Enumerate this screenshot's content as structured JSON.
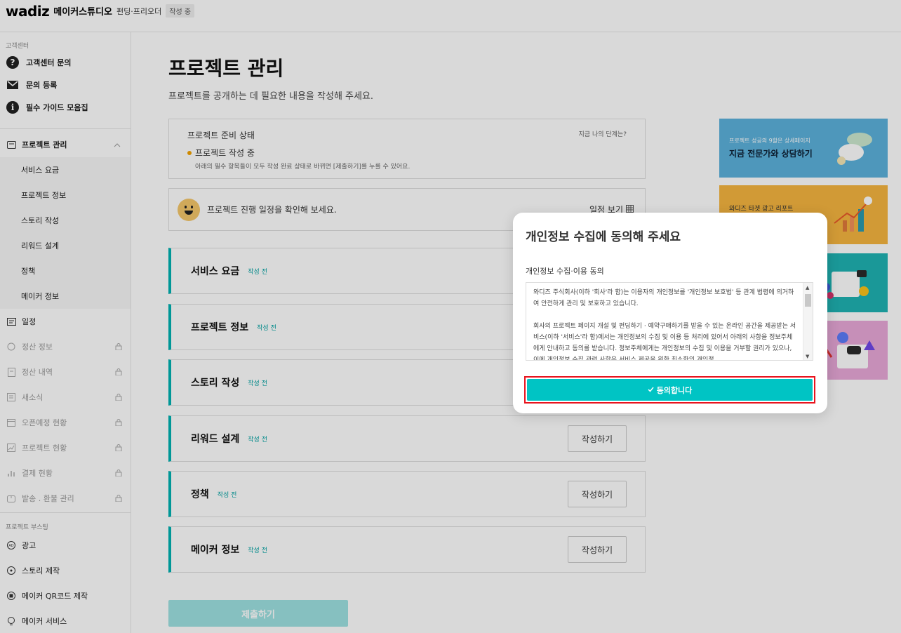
{
  "header": {
    "logo": "wadiz",
    "studio": "메이커스튜디오",
    "subtitle": "펀딩·프리오더",
    "badge": "작성 중"
  },
  "sidebar": {
    "support_label": "고객센터",
    "support_items": [
      {
        "label": "고객센터 문의",
        "icon": "question-icon"
      },
      {
        "label": "문의 등록",
        "icon": "mail-icon"
      },
      {
        "label": "필수 가이드 모음집",
        "icon": "info-icon"
      }
    ],
    "project_manage": "프로젝트 관리",
    "project_sub": [
      "서비스 요금",
      "프로젝트 정보",
      "스토리 작성",
      "리워드 설계",
      "정책",
      "메이커 정보"
    ],
    "schedule": "일정",
    "locked_items": [
      "정산 정보",
      "정산 내역",
      "새소식",
      "오픈예정 현황",
      "프로젝트 현황",
      "결제 현황",
      "발송 . 환불 관리"
    ],
    "boost_label": "프로젝트 부스팅",
    "boost_items": [
      "광고",
      "스토리 제작",
      "메이커 QR코드 제작",
      "메이커 서비스"
    ]
  },
  "main": {
    "title": "프로젝트 관리",
    "desc": "프로젝트를 공개하는 데 필요한 내용을 작성해 주세요.",
    "status": {
      "title": "프로젝트 준비 상태",
      "question": "지금 나의 단계는?",
      "state": "프로젝트 작성 중",
      "note": "아래의 필수 항목들이 모두 작성 완료 상태로 바뀌면 [제출하기]를 누를 수 있어요."
    },
    "schedule": {
      "text": "프로젝트 진행 일정을 확인해 보세요.",
      "link": "일정 보기"
    },
    "sections": [
      {
        "title": "서비스 요금",
        "status": "작성 전",
        "button": ""
      },
      {
        "title": "프로젝트 정보",
        "status": "작성 전",
        "button": ""
      },
      {
        "title": "스토리 작성",
        "status": "작성 전",
        "button": ""
      },
      {
        "title": "리워드 설계",
        "status": "작성 전",
        "button": "작성하기"
      },
      {
        "title": "정책",
        "status": "작성 전",
        "button": "작성하기"
      },
      {
        "title": "메이커 정보",
        "status": "작성 전",
        "button": "작성하기"
      }
    ],
    "submit": "제출하기"
  },
  "banners": [
    {
      "small": "프로젝트 성공의 9할은 상세페이지",
      "big": "지금 전문가와 상담하기"
    },
    {
      "small": "와디즈 타겟 광고 리포트"
    }
  ],
  "modal": {
    "title": "개인정보 수집에 동의해 주세요",
    "label": "개인정보 수집·이용 동의",
    "terms_p1": "와디즈 주식회사(이하 '회사'라 함)는 이용자의 개인정보를 '개인정보 보호법' 등 관계 법령에 의거하여 안전하게 관리 및 보호하고 있습니다.",
    "terms_p2": "회사의 프로젝트 페이지 개설 및 펀딩하기 · 예약구매하기를 받을 수 있는 온라인 공간을 제공받는 서비스(이하 '서비스'라 함)에서는 개인정보의 수집 및 이용 등 처리에 있어서 아래의 사항을 정보주체에게 안내하고 동의를 받습니다. 정보주체에게는 개인정보의 수집 및 이용을 거부할 권리가 있으나, 이에 개인정보 수집 관련 사항은 서비스 제공을 위한 최소한의 개인정",
    "agree": "동의합니다"
  }
}
